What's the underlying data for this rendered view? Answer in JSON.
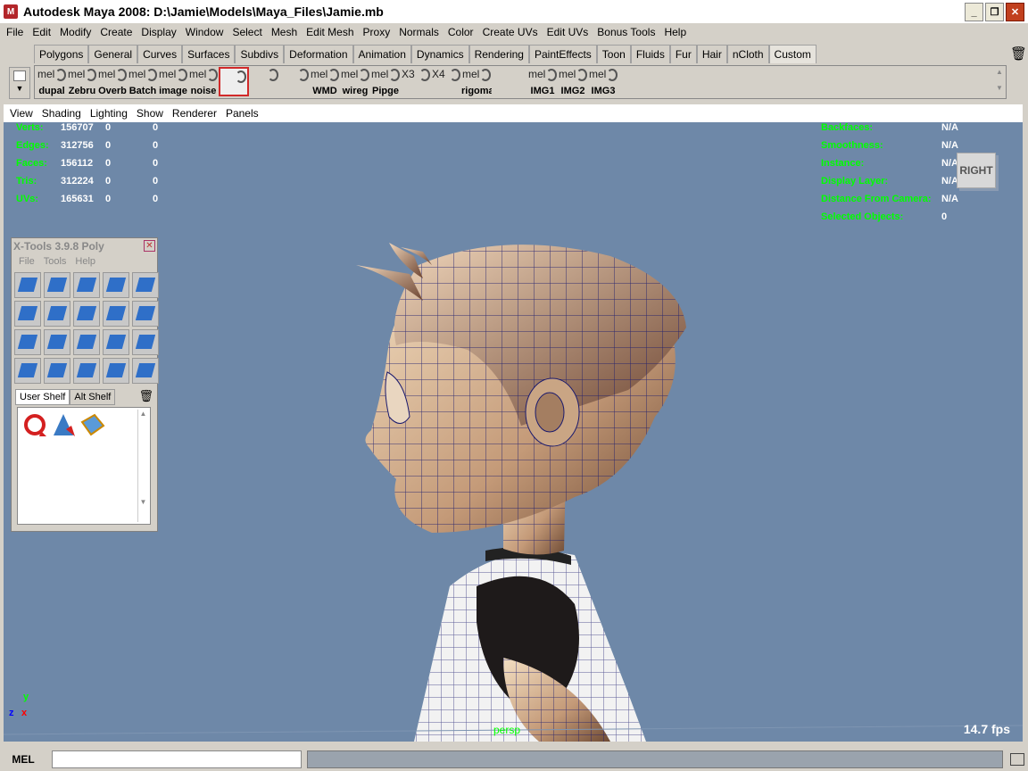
{
  "window": {
    "title": "Autodesk Maya 2008: D:\\Jamie\\Models\\Maya_Files\\Jamie.mb",
    "app_icon": "M"
  },
  "menu": [
    "File",
    "Edit",
    "Modify",
    "Create",
    "Display",
    "Window",
    "Select",
    "Mesh",
    "Edit Mesh",
    "Proxy",
    "Normals",
    "Color",
    "Create UVs",
    "Edit UVs",
    "Bonus Tools",
    "Help"
  ],
  "shelf_tabs": [
    "Polygons",
    "General",
    "Curves",
    "Surfaces",
    "Subdivs",
    "Deformation",
    "Animation",
    "Dynamics",
    "Rendering",
    "PaintEffects",
    "Toon",
    "Fluids",
    "Fur",
    "Hair",
    "nCloth",
    "Custom"
  ],
  "shelf_tab_active": "Custom",
  "shelf_buttons": [
    {
      "top": "mel",
      "label": "dupal"
    },
    {
      "top": "mel",
      "label": "Zebru"
    },
    {
      "top": "mel",
      "label": "Overb"
    },
    {
      "top": "mel",
      "label": "Batch"
    },
    {
      "top": "mel",
      "label": "image"
    },
    {
      "top": "mel",
      "label": "noise"
    },
    {
      "top": "",
      "label": ""
    },
    {
      "top": "",
      "label": ""
    },
    {
      "top": "",
      "label": ""
    },
    {
      "top": "mel",
      "label": "WMD"
    },
    {
      "top": "mel",
      "label": "wireg"
    },
    {
      "top": "mel",
      "label": "Pipge"
    },
    {
      "top": "X3",
      "label": ""
    },
    {
      "top": "X4",
      "label": ""
    },
    {
      "top": "mel",
      "label": "rigoma"
    },
    {
      "top": "mel",
      "label": "IMG1"
    },
    {
      "top": "mel",
      "label": "IMG2"
    },
    {
      "top": "mel",
      "label": "IMG3"
    }
  ],
  "viewport_menu": [
    "View",
    "Shading",
    "Lighting",
    "Show",
    "Renderer",
    "Panels"
  ],
  "hud_left": [
    {
      "k": "Verts:",
      "v": "156707",
      "a": "0",
      "b": "0"
    },
    {
      "k": "Edges:",
      "v": "312756",
      "a": "0",
      "b": "0"
    },
    {
      "k": "Faces:",
      "v": "156112",
      "a": "0",
      "b": "0"
    },
    {
      "k": "Tris:",
      "v": "312224",
      "a": "0",
      "b": "0"
    },
    {
      "k": "UVs:",
      "v": "165631",
      "a": "0",
      "b": "0"
    }
  ],
  "hud_right": [
    {
      "k": "Backfaces:",
      "v": "N/A"
    },
    {
      "k": "Smoothness:",
      "v": "N/A"
    },
    {
      "k": "Instance:",
      "v": "N/A"
    },
    {
      "k": "Display Layer:",
      "v": "N/A"
    },
    {
      "k": "Distance From Camera:",
      "v": "N/A"
    },
    {
      "k": "Selected Objects:",
      "v": "0"
    }
  ],
  "viewcube_label": "RIGHT",
  "fps": "14.7 fps",
  "camera": "persp",
  "axis": {
    "y": "y",
    "z": "z",
    "x": "x"
  },
  "xtools": {
    "title": "X-Tools 3.9.8 Poly",
    "menu": [
      "File",
      "Tools",
      "Help"
    ],
    "tabs": [
      "User Shelf",
      "Alt Shelf"
    ],
    "icon_count": 20
  },
  "command_line": {
    "label": "MEL",
    "value": ""
  },
  "colors": {
    "viewport_bg": "#6e88a8",
    "hud_label": "#00ff00",
    "hud_value": "#ffffff"
  }
}
